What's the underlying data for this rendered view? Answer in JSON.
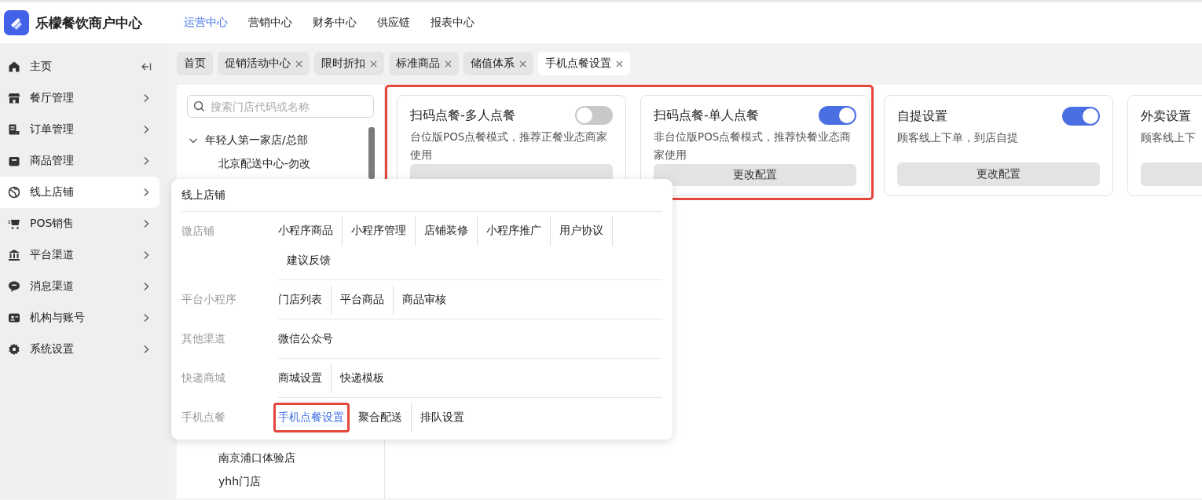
{
  "brand": {
    "name": "乐檬餐饮商户中心"
  },
  "top_nav": [
    {
      "label": "运营中心",
      "selected": true
    },
    {
      "label": "营销中心",
      "selected": false
    },
    {
      "label": "财务中心",
      "selected": false
    },
    {
      "label": "供应链",
      "selected": false
    },
    {
      "label": "报表中心",
      "selected": false
    }
  ],
  "sidebar": {
    "items": [
      {
        "label": "主页",
        "kind": "home",
        "hovered": false
      },
      {
        "label": "餐厅管理",
        "kind": "menu",
        "hovered": false
      },
      {
        "label": "订单管理",
        "kind": "menu",
        "hovered": false
      },
      {
        "label": "商品管理",
        "kind": "menu",
        "hovered": false
      },
      {
        "label": "线上店铺",
        "kind": "menu",
        "hovered": true
      },
      {
        "label": "POS销售",
        "kind": "menu",
        "hovered": false
      },
      {
        "label": "平台渠道",
        "kind": "menu",
        "hovered": false
      },
      {
        "label": "消息渠道",
        "kind": "menu",
        "hovered": false
      },
      {
        "label": "机构与账号",
        "kind": "menu",
        "hovered": false
      },
      {
        "label": "系统设置",
        "kind": "menu",
        "hovered": false
      }
    ]
  },
  "tabs": [
    {
      "label": "首页",
      "closable": false,
      "selected": false
    },
    {
      "label": "促销活动中心",
      "closable": true,
      "selected": false
    },
    {
      "label": "限时折扣",
      "closable": true,
      "selected": false
    },
    {
      "label": "标准商品",
      "closable": true,
      "selected": false
    },
    {
      "label": "储值体系",
      "closable": true,
      "selected": false
    },
    {
      "label": "手机点餐设置",
      "closable": true,
      "selected": true
    }
  ],
  "store_tree": {
    "search": {
      "placeholder": "搜索门店代码或名称"
    },
    "nodes": [
      {
        "label": "年轻人第一家店/总部",
        "expanded": true,
        "children": [
          {
            "label": "北京配送中心-勿改"
          },
          {
            "label": "南京浦口体验店",
            "after_gap": true
          },
          {
            "label": "yhh门店"
          }
        ]
      }
    ]
  },
  "cards": [
    {
      "title": "扫码点餐-多人点餐",
      "on": false,
      "description": "台位版POS点餐模式，推荐正餐业态商家使用",
      "highlighted": true
    },
    {
      "title": "扫码点餐-单人点餐",
      "on": true,
      "description": "非台位版POS点餐模式，推荐快餐业态商家使用",
      "button": "更改配置",
      "highlighted": true
    },
    {
      "title": "自提设置",
      "on": true,
      "description": "顾客线上下单，到店自提",
      "button": "更改配置",
      "highlighted": false
    },
    {
      "title": "外卖设置",
      "description": "顾客线上下",
      "highlighted": false
    }
  ],
  "popup": {
    "title": "线上店铺",
    "groups": [
      {
        "label": "微店铺",
        "links": [
          {
            "label": "小程序商品",
            "selected": false,
            "highlighted": false
          },
          {
            "label": "小程序管理",
            "selected": false,
            "highlighted": false
          },
          {
            "label": "店铺装修",
            "selected": false,
            "highlighted": false
          },
          {
            "label": "小程序推广",
            "selected": false,
            "highlighted": false
          },
          {
            "label": "用户协议",
            "selected": false,
            "highlighted": false
          },
          {
            "label": "建议反馈",
            "selected": false,
            "highlighted": false
          }
        ]
      },
      {
        "label": "平台小程序",
        "links": [
          {
            "label": "门店列表",
            "selected": false,
            "highlighted": false
          },
          {
            "label": "平台商品",
            "selected": false,
            "highlighted": false
          },
          {
            "label": "商品审核",
            "selected": false,
            "highlighted": false
          }
        ]
      },
      {
        "label": "其他渠道",
        "links": [
          {
            "label": "微信公众号",
            "selected": false,
            "highlighted": false
          }
        ]
      },
      {
        "label": "快递商城",
        "links": [
          {
            "label": "商城设置",
            "selected": false,
            "highlighted": false
          },
          {
            "label": "快递模板",
            "selected": false,
            "highlighted": false
          }
        ]
      },
      {
        "label": "手机点餐",
        "links": [
          {
            "label": "手机点餐设置",
            "selected": true,
            "highlighted": true
          },
          {
            "label": "聚合配送",
            "selected": false,
            "highlighted": false
          },
          {
            "label": "排队设置",
            "selected": false,
            "highlighted": false
          }
        ]
      }
    ]
  }
}
